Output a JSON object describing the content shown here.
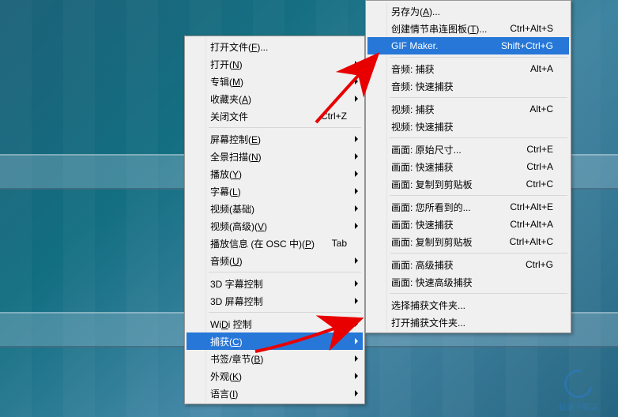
{
  "menu1": {
    "groups": [
      [
        {
          "label": "打开文件(<u>F</u>)...",
          "shortcut": "",
          "arrow": false
        },
        {
          "label": "打开(<u>N</u>)",
          "shortcut": "",
          "arrow": true
        },
        {
          "label": "专辑(<u>M</u>)",
          "shortcut": "",
          "arrow": true
        },
        {
          "label": "收藏夹(<u>A</u>)",
          "shortcut": "",
          "arrow": true
        },
        {
          "label": "关闭文件",
          "shortcut": "Ctrl+Z",
          "arrow": false
        }
      ],
      [
        {
          "label": "屏幕控制(<u>E</u>)",
          "shortcut": "",
          "arrow": true
        },
        {
          "label": "全景扫描(<u>N</u>)",
          "shortcut": "",
          "arrow": true
        },
        {
          "label": "播放(<u>Y</u>)",
          "shortcut": "",
          "arrow": true
        },
        {
          "label": "字幕(<u>L</u>)",
          "shortcut": "",
          "arrow": true
        },
        {
          "label": "视频(基础)",
          "shortcut": "",
          "arrow": true
        },
        {
          "label": "视频(高级)(<u>V</u>)",
          "shortcut": "",
          "arrow": true
        },
        {
          "label": "播放信息 (在 OSC 中)(<u>P</u>)",
          "shortcut": "Tab",
          "arrow": false
        },
        {
          "label": "音频(<u>U</u>)",
          "shortcut": "",
          "arrow": true
        }
      ],
      [
        {
          "label": "3D 字幕控制",
          "shortcut": "",
          "arrow": true
        },
        {
          "label": "3D 屏幕控制",
          "shortcut": "",
          "arrow": true
        }
      ],
      [
        {
          "label": "Wi<u>D</u>i 控制",
          "shortcut": "",
          "arrow": true
        },
        {
          "label": "捕获(<u>C</u>)",
          "shortcut": "",
          "arrow": true,
          "highlight": true
        },
        {
          "label": "书签/章节(<u>B</u>)",
          "shortcut": "",
          "arrow": true
        },
        {
          "label": "外观(<u>K</u>)",
          "shortcut": "",
          "arrow": true
        },
        {
          "label": "语言(<u>I</u>)",
          "shortcut": "",
          "arrow": true
        }
      ]
    ]
  },
  "menu2": {
    "groups": [
      [
        {
          "label": "另存为(<u>A</u>)...",
          "shortcut": "",
          "arrow": false
        },
        {
          "label": "创建情节串连图板(<u>T</u>)...",
          "shortcut": "Ctrl+Alt+S",
          "arrow": false
        },
        {
          "label": "GIF Maker.",
          "shortcut": "Shift+Ctrl+G",
          "arrow": false,
          "highlight": true
        }
      ],
      [
        {
          "label": "音频: 捕获",
          "shortcut": "Alt+A",
          "arrow": false
        },
        {
          "label": "音频: 快速捕获",
          "shortcut": "",
          "arrow": false
        }
      ],
      [
        {
          "label": "视频: 捕获",
          "shortcut": "Alt+C",
          "arrow": false
        },
        {
          "label": "视频: 快速捕获",
          "shortcut": "",
          "arrow": false
        }
      ],
      [
        {
          "label": "画面: 原始尺寸...",
          "shortcut": "Ctrl+E",
          "arrow": false
        },
        {
          "label": "画面: 快速捕获",
          "shortcut": "Ctrl+A",
          "arrow": false
        },
        {
          "label": "画面: 复制到剪贴板",
          "shortcut": "Ctrl+C",
          "arrow": false
        }
      ],
      [
        {
          "label": "画面: 您所看到的...",
          "shortcut": "Ctrl+Alt+E",
          "arrow": false
        },
        {
          "label": "画面: 快速捕获",
          "shortcut": "Ctrl+Alt+A",
          "arrow": false
        },
        {
          "label": "画面: 复制到剪贴板",
          "shortcut": "Ctrl+Alt+C",
          "arrow": false
        }
      ],
      [
        {
          "label": "画面: 高级捕获",
          "shortcut": "Ctrl+G",
          "arrow": false
        },
        {
          "label": "画面: 快速高级捕获",
          "shortcut": "",
          "arrow": false
        }
      ],
      [
        {
          "label": "选择捕获文件夹...",
          "shortcut": "",
          "arrow": false
        },
        {
          "label": "打开捕获文件夹...",
          "shortcut": "",
          "arrow": false
        }
      ]
    ]
  },
  "watermark": "极速下载站"
}
